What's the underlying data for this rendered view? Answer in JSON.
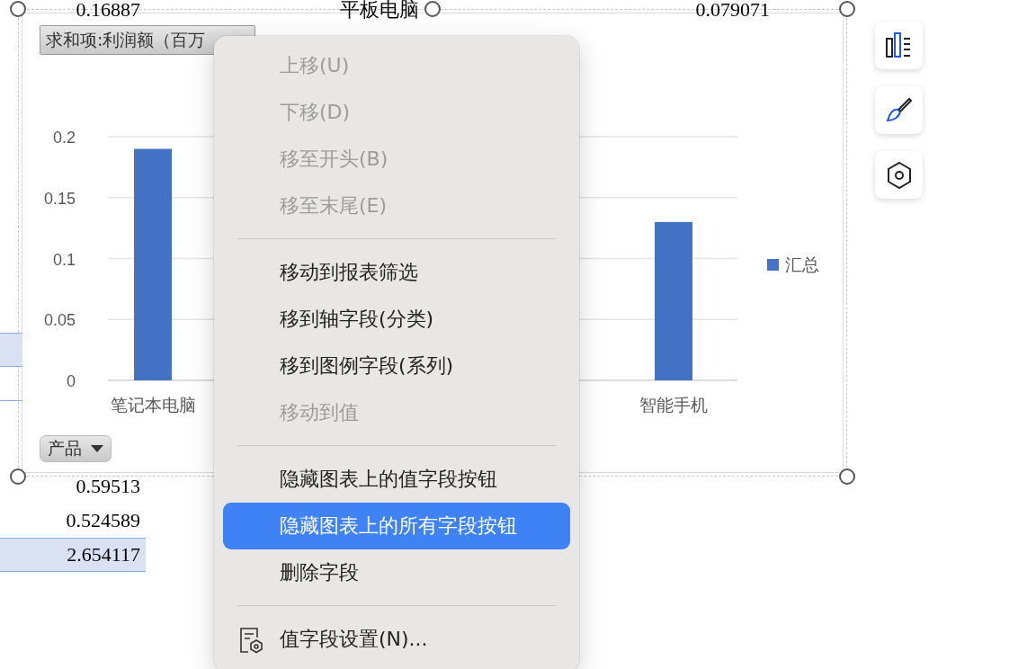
{
  "sheet": {
    "rows": [
      {
        "kind": "plain",
        "column_1": "0.16887",
        "column_2": "平板电脑",
        "column_3": "0.079071"
      },
      {
        "kind": "plain"
      },
      {
        "kind": "plain"
      },
      {
        "kind": "plain"
      },
      {
        "kind": "plain"
      },
      {
        "kind": "plain"
      },
      {
        "kind": "plain"
      },
      {
        "kind": "plain"
      },
      {
        "kind": "plain"
      },
      {
        "kind": "plain"
      },
      {
        "kind": "filled-edge"
      },
      {
        "kind": "bordered-edge"
      },
      {
        "kind": "plain"
      },
      {
        "kind": "plain"
      },
      {
        "kind": "plain",
        "column_1": "0.59513"
      },
      {
        "kind": "plain",
        "column_1": "0.524589"
      },
      {
        "kind": "filled",
        "column_1": "2.654117"
      }
    ]
  },
  "chart": {
    "value_field_button": "求和项:利润额（百万",
    "axis_field_button": "产品",
    "chart_data": {
      "type": "bar",
      "categories": [
        "笔记本电脑",
        null,
        null,
        "智能手机"
      ],
      "series": [
        {
          "name": "汇总",
          "color": "#4472c4",
          "values": [
            0.19,
            null,
            null,
            0.13
          ]
        }
      ],
      "ylim": [
        0,
        0.2
      ],
      "grid": true,
      "yticks": [
        {
          "value": 0,
          "label": "0"
        },
        {
          "value": 0.05,
          "label": "0.05"
        },
        {
          "value": 0.1,
          "label": "0.1"
        },
        {
          "value": 0.15,
          "label": "0.15"
        },
        {
          "value": 0.2,
          "label": "0.2"
        }
      ]
    }
  },
  "context_menu": {
    "items": [
      {
        "kind": "command",
        "label": "上移(U)",
        "disabled": true,
        "selected": false
      },
      {
        "kind": "command",
        "label": "下移(D)",
        "disabled": true,
        "selected": false
      },
      {
        "kind": "command",
        "label": "移至开头(B)",
        "disabled": true,
        "selected": false
      },
      {
        "kind": "command",
        "label": "移至末尾(E)",
        "disabled": true,
        "selected": false
      },
      {
        "kind": "separator"
      },
      {
        "kind": "command",
        "label": "移动到报表筛选",
        "disabled": false,
        "selected": false
      },
      {
        "kind": "command",
        "label": "移到轴字段(分类)",
        "disabled": false,
        "selected": false
      },
      {
        "kind": "command",
        "label": "移到图例字段(系列)",
        "disabled": false,
        "selected": false
      },
      {
        "kind": "command",
        "label": "移动到值",
        "disabled": true,
        "selected": false
      },
      {
        "kind": "separator"
      },
      {
        "kind": "command",
        "label": "隐藏图表上的值字段按钮",
        "disabled": false,
        "selected": false
      },
      {
        "kind": "command",
        "label": "隐藏图表上的所有字段按钮",
        "disabled": false,
        "selected": true
      },
      {
        "kind": "command",
        "label": "删除字段",
        "disabled": false,
        "selected": false
      },
      {
        "kind": "separator"
      },
      {
        "kind": "settings",
        "label": "值字段设置(N)...",
        "disabled": false,
        "selected": false
      }
    ]
  },
  "side_toolbar": {
    "buttons": [
      {
        "kind": "chart-elements"
      },
      {
        "kind": "style"
      },
      {
        "kind": "filter"
      }
    ]
  }
}
